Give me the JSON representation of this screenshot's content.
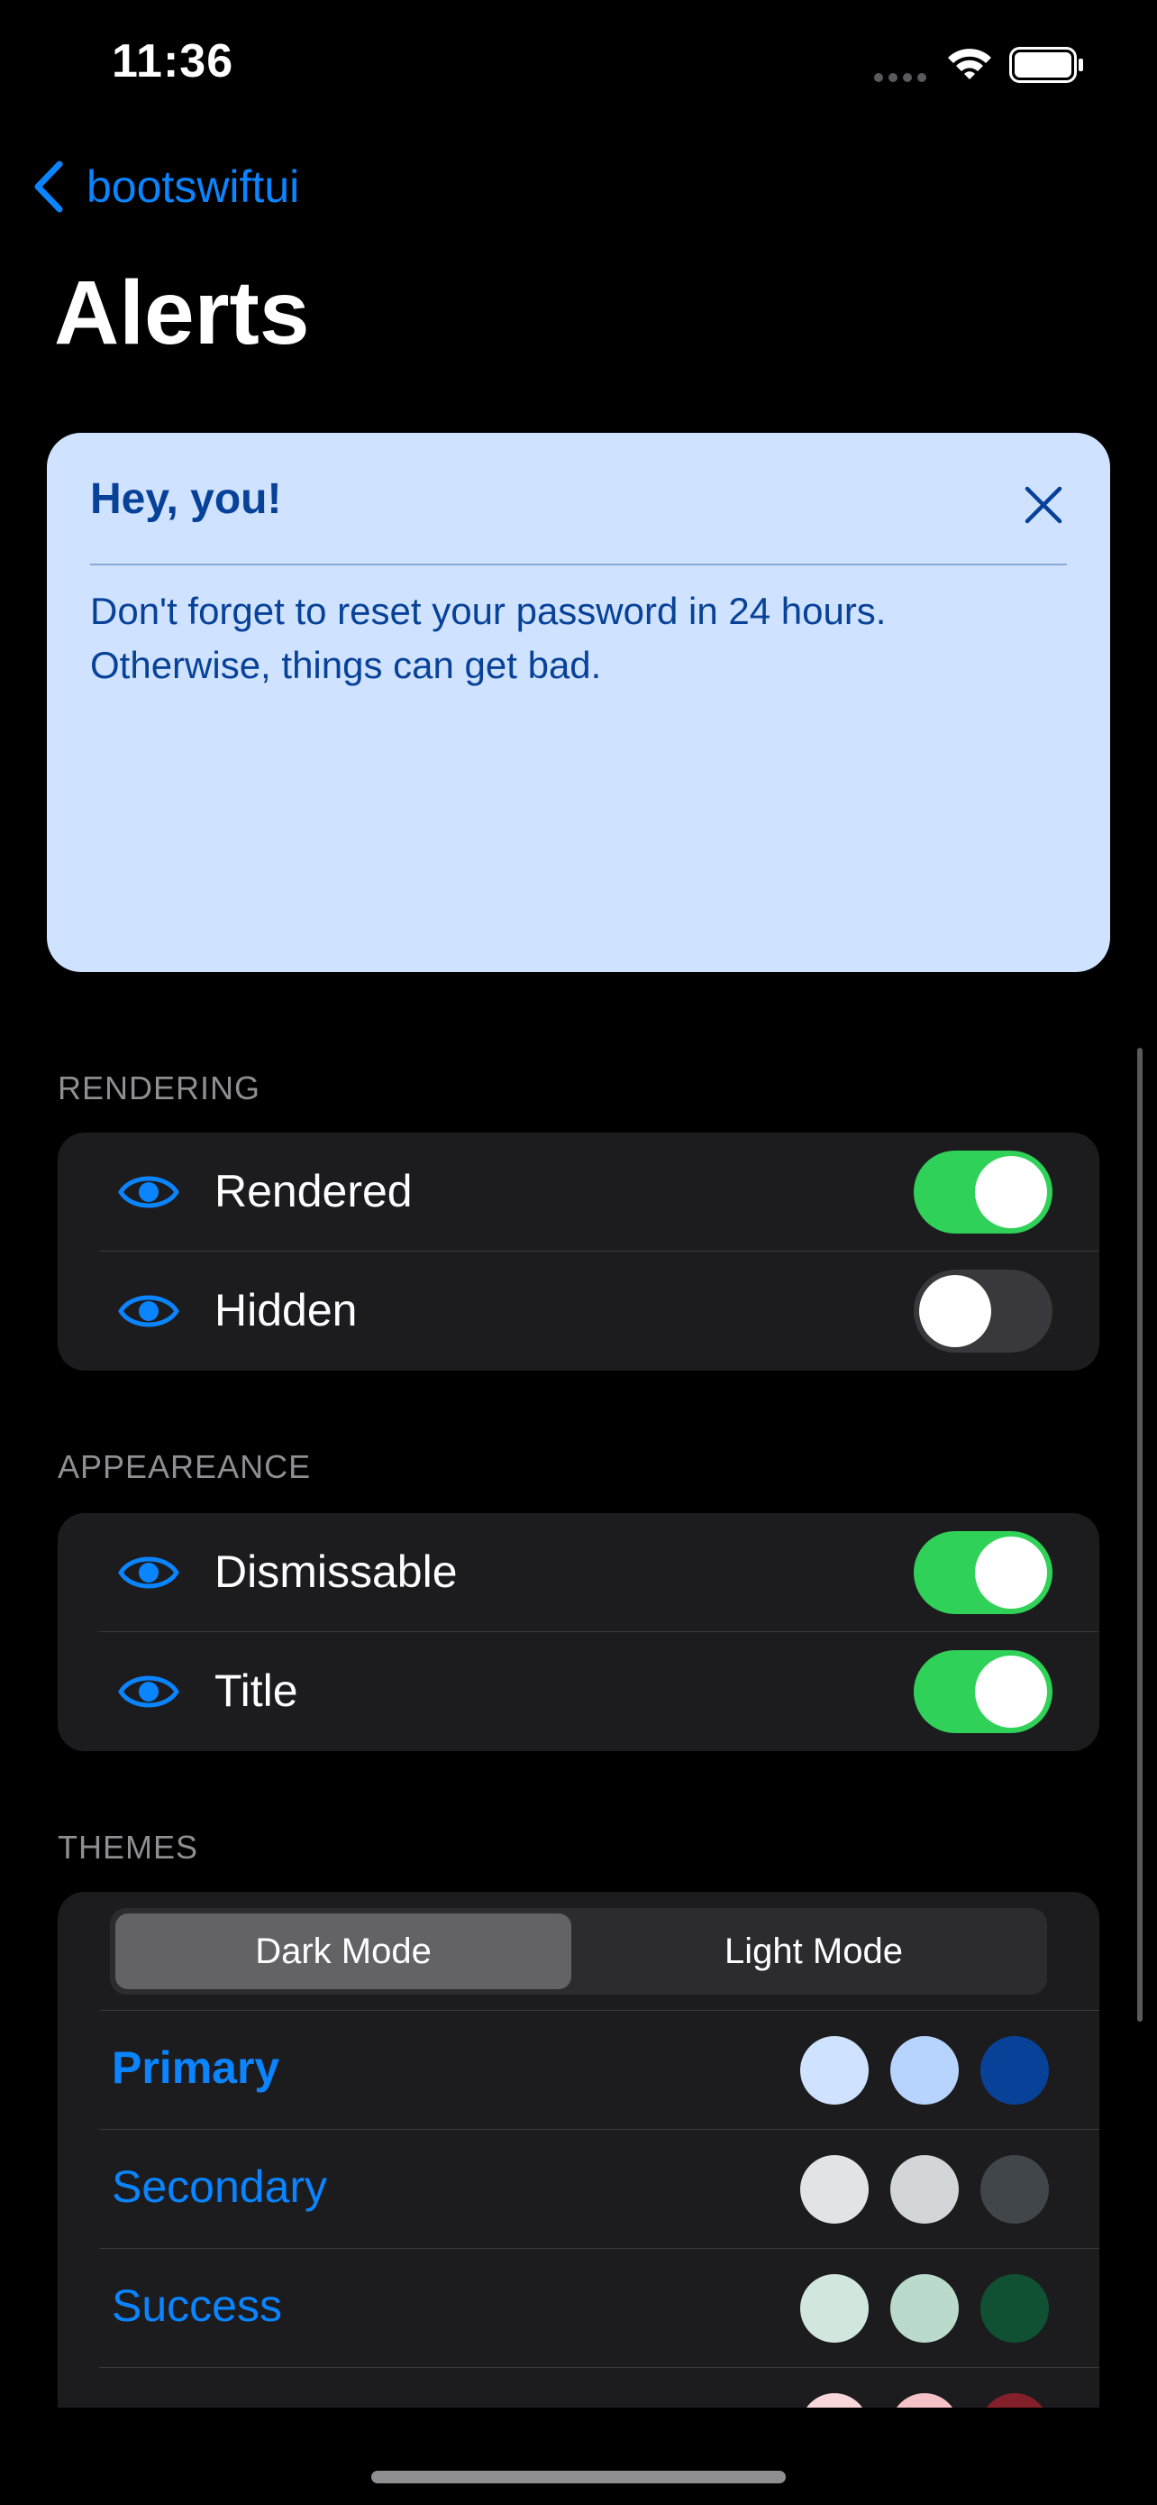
{
  "status_bar": {
    "time": "11:36"
  },
  "nav": {
    "back_label": "bootswiftui",
    "title": "Alerts"
  },
  "alert": {
    "title": "Hey, you!",
    "body": "Don't forget to reset your password in 24 hours. Otherwise, things can get bad.",
    "background": "#cfe2ff",
    "text_color": "#084298"
  },
  "rendering": {
    "header": "RENDERING",
    "rows": [
      {
        "label": "Rendered",
        "on": true
      },
      {
        "label": "Hidden",
        "on": false
      }
    ]
  },
  "appearance": {
    "header": "APPEAREANCE",
    "rows": [
      {
        "label": "Dismissable",
        "on": true
      },
      {
        "label": "Title",
        "on": true
      }
    ]
  },
  "themes": {
    "header": "THEMES",
    "segments": [
      "Dark Mode",
      "Light Mode"
    ],
    "selected_segment": "Dark Mode",
    "items": [
      {
        "label": "Primary",
        "selected": true,
        "swatches": [
          "#cfe2ff",
          "#b6d4fe",
          "#084298"
        ]
      },
      {
        "label": "Secondary",
        "selected": false,
        "swatches": [
          "#e2e3e5",
          "#d3d6d8",
          "#41464b"
        ]
      },
      {
        "label": "Success",
        "selected": false,
        "swatches": [
          "#d1e7dd",
          "#badbcc",
          "#0f5132"
        ]
      },
      {
        "label": "",
        "selected": false,
        "swatches": [
          "#f8d7da",
          "#f5c2c7",
          "#842029"
        ]
      }
    ]
  },
  "colors": {
    "accent": "#0a84ff",
    "toggle_on": "#30d158",
    "group_bg": "#1c1c1e"
  }
}
